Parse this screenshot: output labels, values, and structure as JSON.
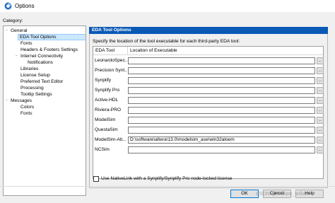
{
  "window": {
    "title": "Options"
  },
  "category_label": "Category:",
  "tree": {
    "items": [
      {
        "label": "General",
        "expander": "−"
      },
      {
        "label": "EDA Tool Options"
      },
      {
        "label": "Fonts"
      },
      {
        "label": "Headers & Footers Settings"
      },
      {
        "label": "Internet Connectivity",
        "expander": "−"
      },
      {
        "label": "Notifications"
      },
      {
        "label": "Libraries"
      },
      {
        "label": "License Setup"
      },
      {
        "label": "Preferred Text Editor"
      },
      {
        "label": "Processing"
      },
      {
        "label": "Tooltip Settings"
      },
      {
        "label": "Messages",
        "expander": "−"
      },
      {
        "label": "Colors"
      },
      {
        "label": "Fonts"
      }
    ],
    "selected": "EDA Tool Options"
  },
  "panel": {
    "header": "EDA Tool Options",
    "description": "Specify the location of the tool executable for each third-party EDA tool:",
    "columns": [
      "EDA Tool",
      "Location of Executable"
    ],
    "browse_label": "...",
    "rows": [
      {
        "tool": "LeonardoSpec...",
        "location": ""
      },
      {
        "tool": "Precision Synt...",
        "location": ""
      },
      {
        "tool": "Synplify",
        "location": ""
      },
      {
        "tool": "Synplify Pro",
        "location": ""
      },
      {
        "tool": "Active-HDL",
        "location": ""
      },
      {
        "tool": "Riviera-PRO",
        "location": ""
      },
      {
        "tool": "ModelSim",
        "location": ""
      },
      {
        "tool": "QuestaSim",
        "location": ""
      },
      {
        "tool": "ModelSim-Alt...",
        "location": "D:\\software\\altera\\13.0\\modelsim_ase\\win32aloem"
      },
      {
        "tool": "NCSim",
        "location": ""
      }
    ],
    "nativelink_checkbox": {
      "label": "Use NativeLink with a Synplify/Synplify Pro node-locked license",
      "checked": false
    }
  },
  "buttons": {
    "ok": "OK",
    "cancel": "Cancel",
    "help": "Help"
  },
  "watermark": "CSDN @William_william",
  "colors": {
    "header_bg": "#0a59b5",
    "selection_bg": "#cce8ff"
  }
}
